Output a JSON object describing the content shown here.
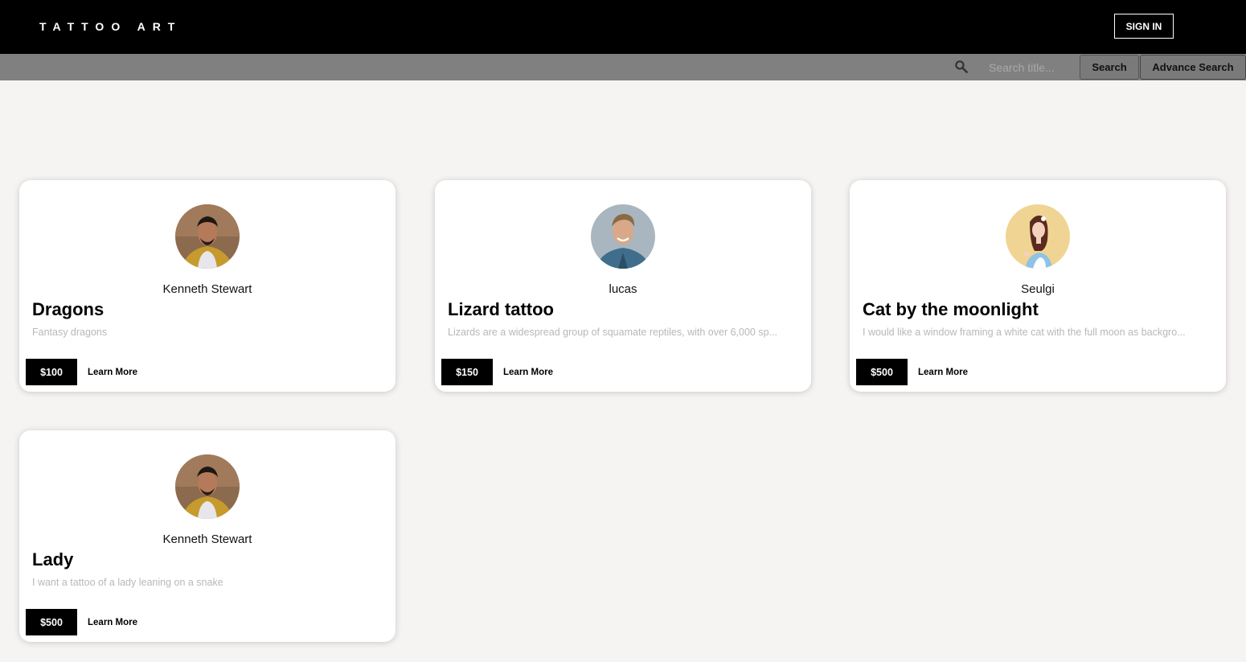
{
  "header": {
    "brand": "TATTOO ART",
    "signin_label": "SIGN IN"
  },
  "search": {
    "placeholder": "Search title...",
    "value": "",
    "search_label": "Search",
    "advanced_label": "Advance Search"
  },
  "colors": {
    "topbar": "#000000",
    "searchbar": "#808080",
    "background": "#f5f4f2",
    "price_badge": "#000000",
    "description_text": "#b8b8b8"
  },
  "cards": [
    {
      "author": "Kenneth Stewart",
      "title": "Dragons",
      "description": "Fantasy dragons",
      "price": "$100",
      "learn_more": "Learn More",
      "avatar": "kenneth-avatar"
    },
    {
      "author": "lucas",
      "title": "Lizard tattoo",
      "description": "Lizards are a widespread group of squamate reptiles, with over 6,000 sp...",
      "price": "$150",
      "learn_more": "Learn More",
      "avatar": "lucas-avatar"
    },
    {
      "author": "Seulgi",
      "title": "Cat by the moonlight",
      "description": "I would like a window framing a white cat with the full moon as backgro...",
      "price": "$500",
      "learn_more": "Learn More",
      "avatar": "seulgi-avatar"
    },
    {
      "author": "Kenneth Stewart",
      "title": "Lady",
      "description": "I want a tattoo of a lady leaning on a snake",
      "price": "$500",
      "learn_more": "Learn More",
      "avatar": "kenneth-avatar"
    }
  ]
}
